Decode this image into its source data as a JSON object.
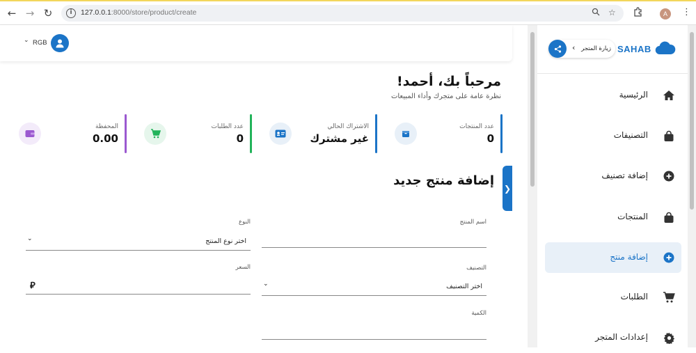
{
  "browser": {
    "url_host": "127.0.0.1",
    "url_path": ":8000/store/product/create",
    "profile_initial": "A"
  },
  "header": {
    "user_name": "RGB"
  },
  "dashboard": {
    "welcome": "مرحباً بك، أحمد!",
    "subtitle": "نظرة عامة على متجرك وأداء المبيعات",
    "stats": [
      {
        "label": "عدد المنتجات",
        "value": "0",
        "color": "#1b74c7",
        "icon": "box-icon"
      },
      {
        "label": "الاشتراك الحالي",
        "value": "غير مشترك",
        "color": "#1b74c7",
        "icon": "id-card-icon"
      },
      {
        "label": "عدد الطلبات",
        "value": "0",
        "color": "#22b35a",
        "icon": "cart-icon"
      },
      {
        "label": "المحفظة",
        "value": "0.00",
        "color": "#9b59d0",
        "icon": "wallet-icon"
      }
    ]
  },
  "form": {
    "title": "إضافة منتج جديد",
    "name_label": "اسم المنتج",
    "type_label": "النوع",
    "type_value": "اختر نوع المنتج",
    "category_label": "التصنيف",
    "category_value": "اختر التصنيف",
    "price_label": "السعر",
    "currency_symbol": "⃁",
    "quantity_label": "الكمية"
  },
  "sidebar": {
    "brand": "SAHAB",
    "visit_store": "زيارة المتجر",
    "accent": "#1b74c7",
    "items": [
      {
        "label": "الرئيسية",
        "icon": "home-icon",
        "active": false
      },
      {
        "label": "التصنيفات",
        "icon": "bag-icon",
        "active": false
      },
      {
        "label": "إضافة تصنيف",
        "icon": "plus-circle-icon",
        "active": false
      },
      {
        "label": "المنتجات",
        "icon": "bag-icon",
        "active": false
      },
      {
        "label": "إضافة منتج",
        "icon": "plus-circle-icon",
        "active": true
      },
      {
        "label": "الطلبات",
        "icon": "cart-icon",
        "active": false
      },
      {
        "label": "إعدادات المتجر",
        "icon": "gear-icon",
        "active": false
      }
    ]
  }
}
